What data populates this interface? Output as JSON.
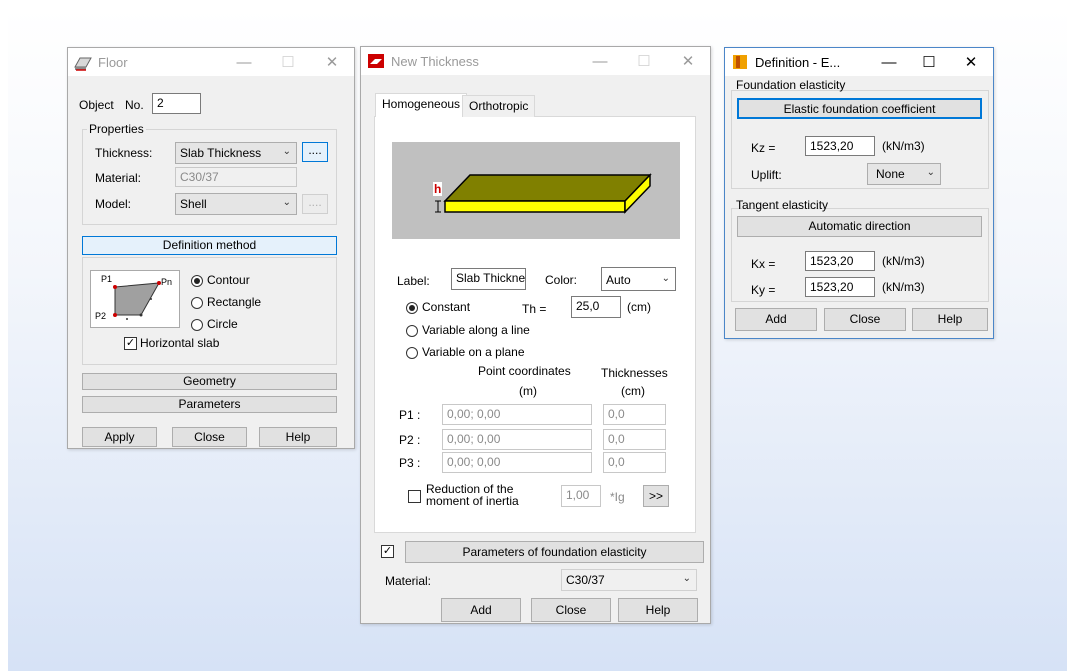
{
  "floor": {
    "title": "Floor",
    "object_label": "Object",
    "no_label": "No.",
    "no_value": "2",
    "properties_title": "Properties",
    "thickness_label": "Thickness:",
    "thickness_value": "Slab Thickness",
    "material_label": "Material:",
    "material_value": "C30/37",
    "model_label": "Model:",
    "model_value": "Shell",
    "ellipsis": "....",
    "definition_method": "Definition method",
    "p1": "P1",
    "pn": "Pn",
    "p2": "P2",
    "contour": "Contour",
    "rectangle": "Rectangle",
    "circle": "Circle",
    "horizontal_slab": "Horizontal slab",
    "geometry": "Geometry",
    "parameters": "Parameters",
    "apply": "Apply",
    "close": "Close",
    "help": "Help"
  },
  "thickness": {
    "title": "New Thickness",
    "tab_homogeneous": "Homogeneous",
    "tab_orthotropic": "Orthotropic",
    "h_letter": "h",
    "label_label": "Label:",
    "label_value": "Slab Thickne",
    "color_label": "Color:",
    "color_value": "Auto",
    "constant": "Constant",
    "th_label": "Th =",
    "th_value": "25,0",
    "th_unit": "(cm)",
    "variable_line": "Variable along a line",
    "variable_plane": "Variable on a plane",
    "point_coords": "Point coordinates",
    "point_unit": "(m)",
    "thicknesses": "Thicknesses",
    "thick_unit": "(cm)",
    "rows": [
      {
        "label": "P1 :",
        "coords": "0,00; 0,00",
        "th": "0,0"
      },
      {
        "label": "P2 :",
        "coords": "0,00; 0,00",
        "th": "0,0"
      },
      {
        "label": "P3 :",
        "coords": "0,00; 0,00",
        "th": "0,0"
      }
    ],
    "reduction_line1": "Reduction of the",
    "reduction_line2": "moment of inertia",
    "reduction_value": "1,00",
    "reduction_unit": "*Ig",
    "more": ">>",
    "found_params": "Parameters of foundation elasticity",
    "material_label": "Material:",
    "material_value": "C30/37",
    "add": "Add",
    "close": "Close",
    "help": "Help"
  },
  "definition": {
    "title": "Definition - E...",
    "foundation_elasticity": "Foundation elasticity",
    "elastic_coeff": "Elastic foundation coefficient",
    "kz_label": "Kz =",
    "kz_value": "1523,20",
    "kz_unit": "(kN/m3)",
    "uplift_label": "Uplift:",
    "uplift_value": "None",
    "tangent_elasticity": "Tangent elasticity",
    "automatic_direction": "Automatic direction",
    "kx_label": "Kx =",
    "kx_value": "1523,20",
    "kx_unit": "(kN/m3)",
    "ky_label": "Ky =",
    "ky_value": "1523,20",
    "ky_unit": "(kN/m3)",
    "add": "Add",
    "close": "Close",
    "help": "Help"
  },
  "colors": {
    "slab_top": "#808000",
    "slab_side": "#ffff00",
    "h_marker": "#cc0000",
    "accent": "#0078d7"
  }
}
